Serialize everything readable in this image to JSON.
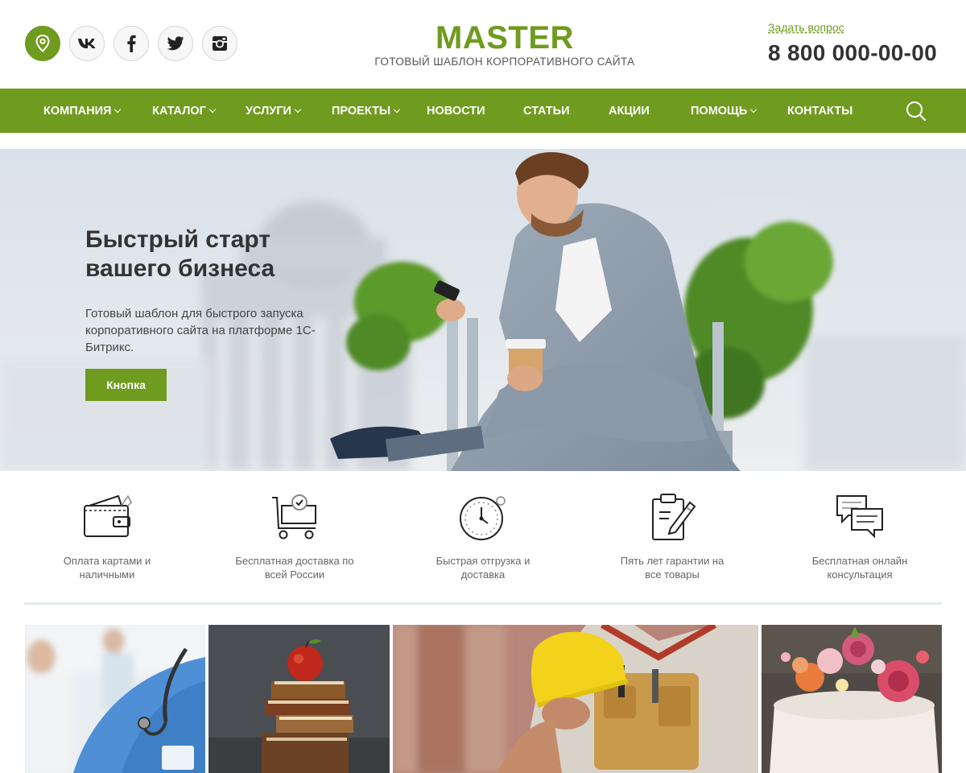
{
  "header": {
    "socials": [
      {
        "icon": "location-pin-icon"
      },
      {
        "icon": "vk-icon"
      },
      {
        "icon": "facebook-icon"
      },
      {
        "icon": "twitter-icon"
      },
      {
        "icon": "instagram-icon"
      }
    ],
    "logo_title": "MASTER",
    "logo_subtitle": "ГОТОВЫЙ ШАБЛОН КОРПОРАТИВНОГО САЙТА",
    "ask_question": "Задать вопрос",
    "phone": "8 800 000-00-00"
  },
  "nav": {
    "items": [
      {
        "label": "КОМПАНИЯ",
        "dropdown": true
      },
      {
        "label": "КАТАЛОГ",
        "dropdown": true
      },
      {
        "label": "УСЛУГИ",
        "dropdown": true
      },
      {
        "label": "ПРОЕКТЫ",
        "dropdown": true
      },
      {
        "label": "НОВОСТИ",
        "dropdown": false
      },
      {
        "label": "СТАТЬИ",
        "dropdown": false
      },
      {
        "label": "АКЦИИ",
        "dropdown": false
      },
      {
        "label": "ПОМОЩЬ",
        "dropdown": true
      },
      {
        "label": "КОНТАКТЫ",
        "dropdown": false
      }
    ],
    "search_icon": "search-icon"
  },
  "hero": {
    "title_line1": "Быстрый старт",
    "title_line2": "вашего бизнеса",
    "description": "Готовый шаблон для быстрого запуска корпоративного сайта на платформе 1С-Битрикс.",
    "button_label": "Кнопка"
  },
  "features": [
    {
      "icon": "wallet-icon",
      "line1": "Оплата картами и",
      "line2": "наличными"
    },
    {
      "icon": "delivery-cart-icon",
      "line1": "Бесплатная доставка по",
      "line2": "всей России"
    },
    {
      "icon": "stopwatch-icon",
      "line1": "Быстрая отгрузка и",
      "line2": "доставка"
    },
    {
      "icon": "warranty-clipboard-icon",
      "line1": "Пять лет гарантии на",
      "line2": "все товары"
    },
    {
      "icon": "chat-bubbles-icon",
      "line1": "Бесплатная онлайн",
      "line2": "консультация"
    }
  ],
  "tiles": [
    {
      "icon": "medical-photo"
    },
    {
      "icon": "education-photo"
    },
    {
      "icon": "construction-photo"
    },
    {
      "icon": "cake-photo"
    }
  ],
  "colors": {
    "brand_green": "#6f9b1f",
    "text_dark": "#333333",
    "text_muted": "#666666"
  }
}
